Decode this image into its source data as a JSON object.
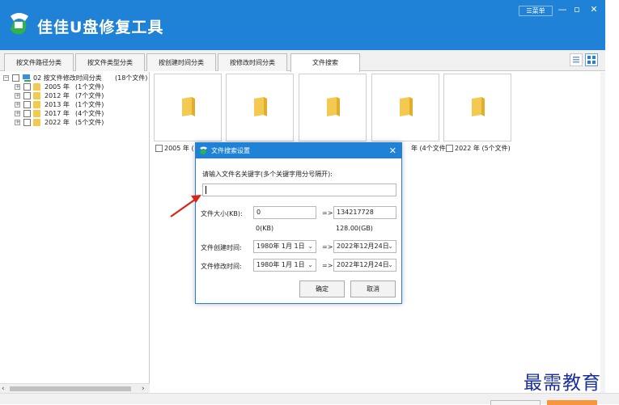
{
  "app": {
    "title": "佳佳U盘修复工具",
    "menu_label": "☰菜单",
    "min_icon": "—",
    "restore_icon": "▫",
    "close_icon": "✕"
  },
  "tabs": [
    {
      "label": "按文件路径分类"
    },
    {
      "label": "按文件类型分类"
    },
    {
      "label": "按创建时间分类"
    },
    {
      "label": "按修改时间分类"
    },
    {
      "label": "文件搜索"
    }
  ],
  "tree": {
    "root_expander": "−",
    "root_label": "02  按文件修改时间分类",
    "root_count": "(18个文件)",
    "items": [
      {
        "year": "2005 年",
        "count": "(1个文件)"
      },
      {
        "year": "2012 年",
        "count": "(7个文件)"
      },
      {
        "year": "2013 年",
        "count": "(1个文件)"
      },
      {
        "year": "2017 年",
        "count": "(4个文件)"
      },
      {
        "year": "2022 年",
        "count": "(5个文件)"
      }
    ],
    "child_expander": "+",
    "scroll_left": "‹",
    "scroll_right": "›"
  },
  "tiles": [
    {
      "label": "2005 年 ("
    },
    {
      "label": ""
    },
    {
      "label": ""
    },
    {
      "label": "年 (4个文件)"
    },
    {
      "label": "2022 年 (5个文件)"
    }
  ],
  "dialog": {
    "title": "文件搜索设置",
    "close": "✕",
    "prompt": "请输入文件名关键字(多个关键字用分号隔开):",
    "keyword_value": "",
    "size_label": "文件大小(KB):",
    "size_min": "0",
    "size_max": "134217728",
    "size_min_sub": "0(KB)",
    "size_max_sub": "128.00(GB)",
    "arrow": "=>",
    "created_label": "文件创建时间:",
    "created_from": "1980年  1月  1日",
    "created_to": "2022年12月24日",
    "modified_label": "文件修改时间:",
    "modified_from": "1980年  1月  1日",
    "modified_to": "2022年12月24日",
    "dropdown_icon": "⌄",
    "ok_label": "确定",
    "cancel_label": "取消"
  },
  "watermark": "最需教育",
  "colors": {
    "brand": "#1f82d6",
    "annotation": "#d9241c",
    "accent": "#f7943c"
  }
}
